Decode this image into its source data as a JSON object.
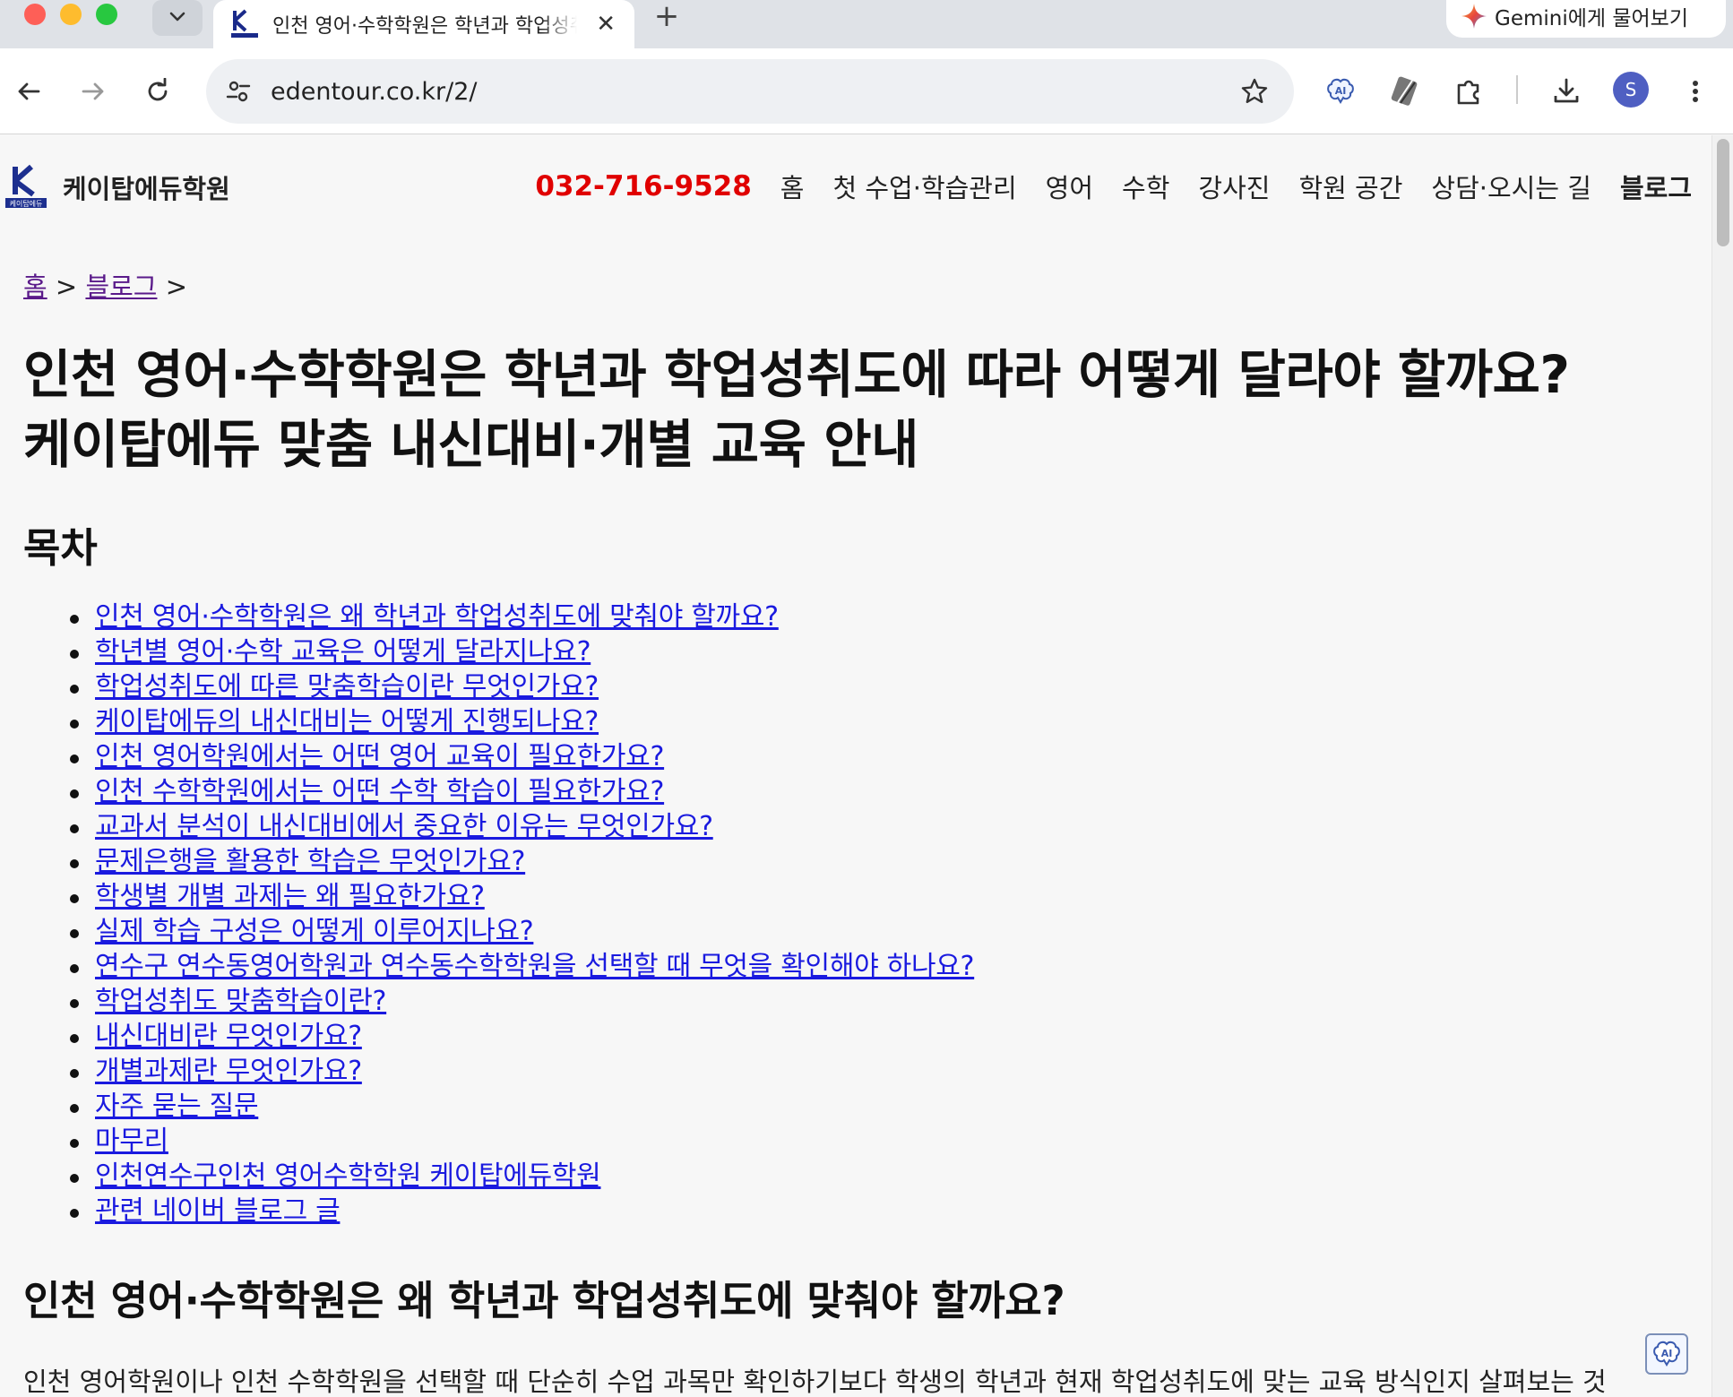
{
  "browser": {
    "tab_title": "인천 영어·수학학원은 학년과 학업성취도에 따라 어떻게",
    "tab_close": "✕",
    "new_tab": "+",
    "gemini_label": "Gemini에게 물어보기",
    "url": "edentour.co.kr/2/",
    "avatar_initial": "S"
  },
  "site": {
    "brand_name": "케이탑에듀학원",
    "logo_caption": "케이탑에듀",
    "phone": "032-716-9528",
    "nav": [
      "홈",
      "첫 수업·학습관리",
      "영어",
      "수학",
      "강사진",
      "학원 공간",
      "상담·오시는 길",
      "블로그"
    ]
  },
  "breadcrumb": {
    "home": "홈",
    "sep1": " > ",
    "blog": "블로그",
    "sep2": " >"
  },
  "article": {
    "title_line1": "인천 영어·수학학원은 학년과 학업성취도에 따라 어떻게 달라야 할까요?",
    "title_line2": "케이탑에듀 맞춤 내신대비·개별 교육 안내",
    "toc_heading": "목차",
    "toc": [
      "인천 영어·수학학원은 왜 학년과 학업성취도에 맞춰야 할까요?",
      "학년별 영어·수학 교육은 어떻게 달라지나요?",
      "학업성취도에 따른 맞춤학습이란 무엇인가요?",
      "케이탑에듀의 내신대비는 어떻게 진행되나요?",
      "인천 영어학원에서는 어떤 영어 교육이 필요한가요?",
      "인천 수학학원에서는 어떤 수학 학습이 필요한가요?",
      "교과서 분석이 내신대비에서 중요한 이유는 무엇인가요?",
      "문제은행을 활용한 학습은 무엇인가요?",
      "학생별 개별 과제는 왜 필요한가요?",
      "실제 학습 구성은 어떻게 이루어지나요?",
      "연수구 연수동영어학원과 연수동수학학원을 선택할 때 무엇을 확인해야 하나요?",
      "학업성취도 맞춤학습이란?",
      "내신대비란 무엇인가요?",
      "개별과제란 무엇인가요?",
      "자주 묻는 질문",
      "마무리",
      "인천연수구인천 영어수학학원 케이탑에듀학원",
      "관련 네이버 블로그 글"
    ],
    "section1_heading": "인천 영어·수학학원은 왜 학년과 학업성취도에 맞춰야 할까요?",
    "section1_text": "인천 영어학원이나 인천 수학학원을 선택할 때 단순히 수업 과목만 확인하기보다 학생의 학년과 현재 학업성취도에 맞는 교육 방식인지 살펴보는 것"
  },
  "colors": {
    "phone": "#e00000",
    "link": "#1a1adf",
    "visited_link": "#5a1a8a",
    "avatar": "#4f5fc2"
  },
  "icons": [
    "tab-list-icon",
    "back-icon",
    "forward-icon",
    "reload-icon",
    "site-settings-icon",
    "bookmark-star-icon",
    "ai-extension-icon",
    "pen-extension-icon",
    "extensions-puzzle-icon",
    "download-icon",
    "more-menu-icon",
    "gemini-sparkle-icon",
    "ai-assistant-icon"
  ]
}
